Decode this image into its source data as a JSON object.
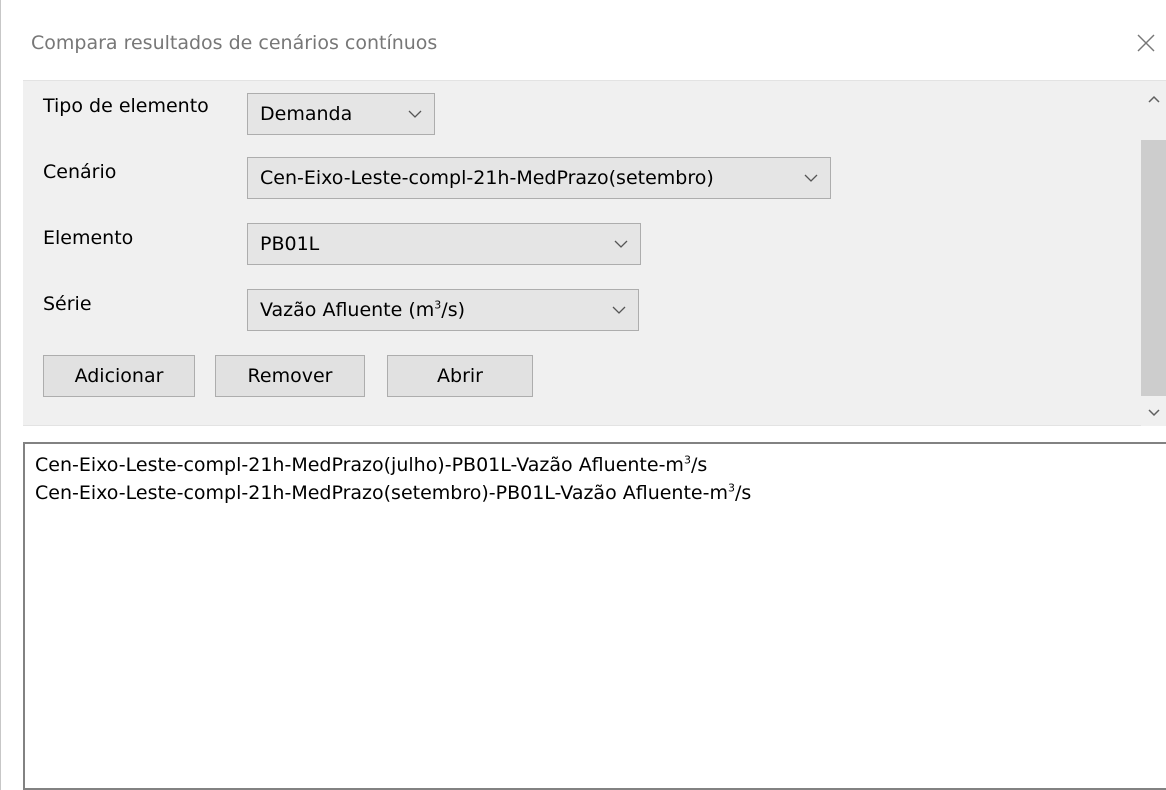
{
  "window": {
    "title": "Compara resultados de cenários contínuos",
    "close_icon": "close-icon"
  },
  "form": {
    "tipo": {
      "label": "Tipo de elemento",
      "value": "Demanda"
    },
    "cenario": {
      "label": "Cenário",
      "value": "Cen-Eixo-Leste-compl-21h-MedPrazo(setembro)"
    },
    "elemento": {
      "label": "Elemento",
      "value": "PB01L"
    },
    "serie": {
      "label": "Série",
      "value_prefix": "Vazão Afluente (m",
      "value_sup": "3",
      "value_suffix": "/s)"
    }
  },
  "buttons": {
    "add": "Adicionar",
    "remove": "Remover",
    "open": "Abrir"
  },
  "list": {
    "items": [
      {
        "prefix": "Cen-Eixo-Leste-compl-21h-MedPrazo(julho)-PB01L-Vazão Afluente-m",
        "sup": "3",
        "suffix": "/s"
      },
      {
        "prefix": "Cen-Eixo-Leste-compl-21h-MedPrazo(setembro)-PB01L-Vazão Afluente-m",
        "sup": "3",
        "suffix": "/s"
      }
    ]
  },
  "icons": {
    "dropdown": "chevron-down-icon",
    "scroll_up": "scroll-up-arrow-icon",
    "scroll_down": "scroll-down-arrow-icon"
  },
  "colors": {
    "panel_bg": "#f0f0f0",
    "combo_bg": "#e5e5e5",
    "button_bg": "#e1e1e1",
    "title_text": "#777777"
  }
}
